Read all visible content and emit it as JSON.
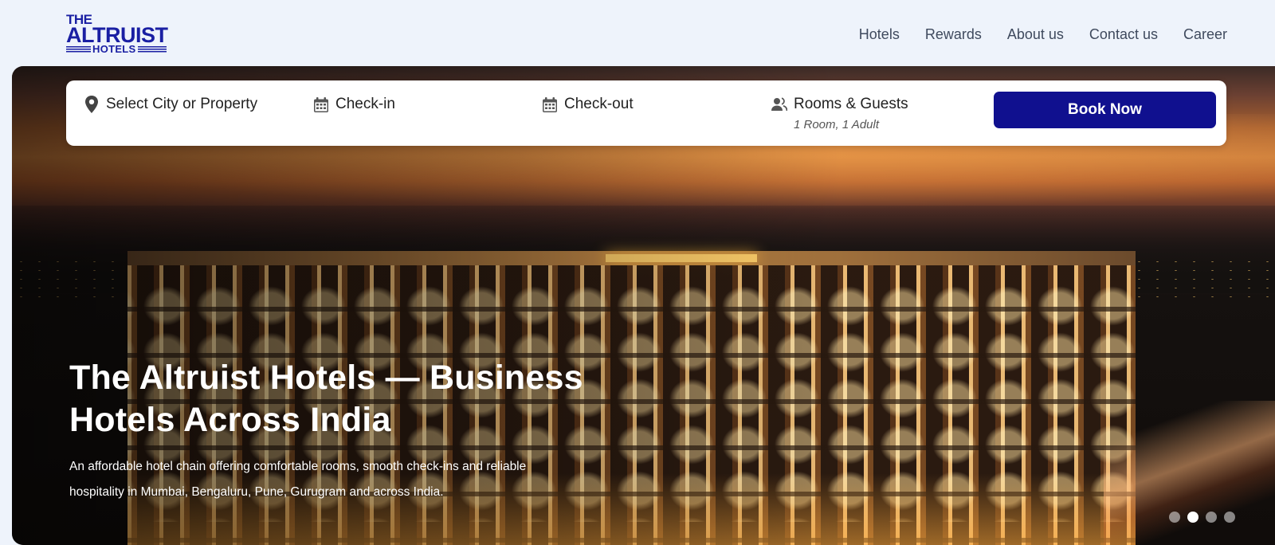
{
  "brand": {
    "line1": "THE",
    "line2": "ALTRUIST",
    "line3": "HOTELS",
    "color": "#1a1fa3"
  },
  "nav": {
    "items": [
      {
        "label": "Hotels"
      },
      {
        "label": "Rewards"
      },
      {
        "label": "About us"
      },
      {
        "label": "Contact us"
      },
      {
        "label": "Career"
      }
    ]
  },
  "booking": {
    "location": {
      "label": "Select City or Property",
      "icon": "map-pin-icon"
    },
    "checkin": {
      "label": "Check-in",
      "icon": "calendar-icon"
    },
    "checkout": {
      "label": "Check-out",
      "icon": "calendar-icon"
    },
    "guests": {
      "label": "Rooms & Guests",
      "value": "1 Room, 1 Adult",
      "icon": "users-icon"
    },
    "book_label": "Book Now",
    "button_color": "#10108f"
  },
  "hero": {
    "title": "The Altruist Hotels — Business Hotels Across India",
    "description": "An affordable hotel chain offering comfortable rooms, smooth check-ins and reliable hospitality in Mumbai, Bengaluru, Pune, Gurugram and across India.",
    "slides_total": 4,
    "active_slide": 2
  }
}
